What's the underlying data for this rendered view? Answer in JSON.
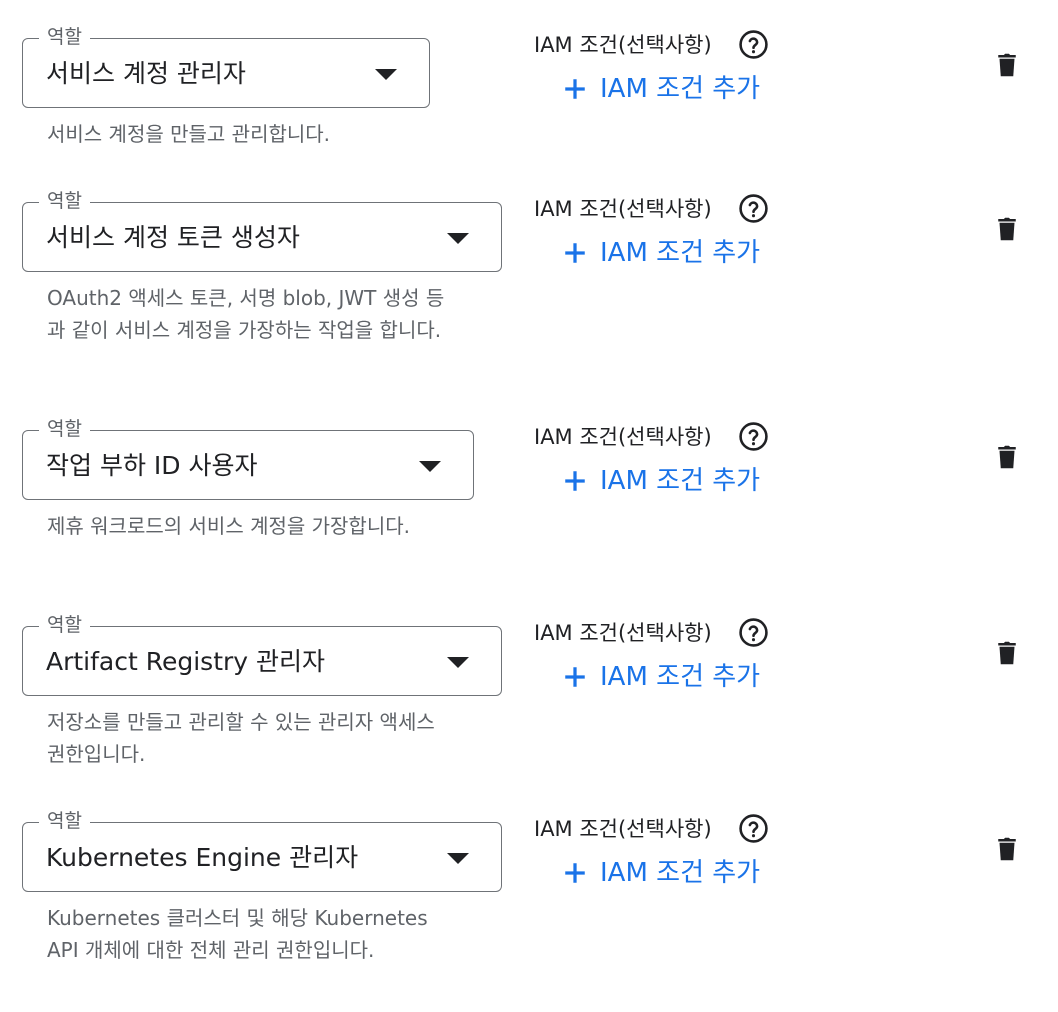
{
  "roles": [
    {
      "field_label": "역할",
      "role": "서비스 계정 관리자",
      "description": "서비스 계정을 만들고 관리합니다.",
      "condition_label": "IAM 조건(선택사항)",
      "add_condition_label": "IAM 조건 추가"
    },
    {
      "field_label": "역할",
      "role": "서비스 계정 토큰 생성자",
      "description": "OAuth2 액세스 토큰, 서명 blob, JWT 생성 등과 같이 서비스 계정을 가장하는 작업을 합니다.",
      "condition_label": "IAM 조건(선택사항)",
      "add_condition_label": "IAM 조건 추가"
    },
    {
      "field_label": "역할",
      "role": "작업 부하 ID 사용자",
      "description": "제휴 워크로드의 서비스 계정을 가장합니다.",
      "condition_label": "IAM 조건(선택사항)",
      "add_condition_label": "IAM 조건 추가"
    },
    {
      "field_label": "역할",
      "role": "Artifact Registry 관리자",
      "description": "저장소를 만들고 관리할 수 있는 관리자 액세스 권한입니다.",
      "condition_label": "IAM 조건(선택사항)",
      "add_condition_label": "IAM 조건 추가"
    },
    {
      "field_label": "역할",
      "role": "Kubernetes Engine 관리자",
      "description": "Kubernetes 클러스터 및 해당 Kubernetes API 개체에 대한 전체 관리 권한입니다.",
      "condition_label": "IAM 조건(선택사항)",
      "add_condition_label": "IAM 조건 추가"
    }
  ],
  "icons": {
    "help": "help-circle-icon",
    "add": "plus-icon",
    "delete": "trash-icon",
    "dropdown": "caret-down-icon"
  },
  "colors": {
    "accent": "#1a73e8",
    "text_primary": "#202124",
    "text_secondary": "#5f6368",
    "outline": "#6f7378"
  }
}
